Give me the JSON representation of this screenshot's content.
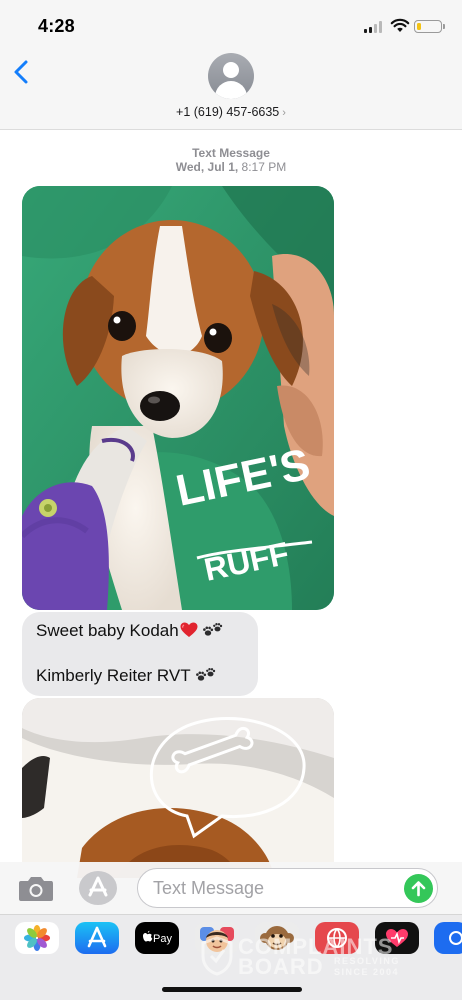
{
  "status_bar": {
    "time": "4:28",
    "cellular_icon": "cellular-signal-icon",
    "wifi_icon": "wifi-icon",
    "battery_icon": "battery-icon",
    "battery_level": 0.2,
    "battery_color": "#f3c316"
  },
  "header": {
    "back_icon": "chevron-left-icon",
    "avatar_icon": "person-avatar-icon",
    "contact": "+1 (619) 457-6635",
    "contact_chevron": "›"
  },
  "thread": {
    "service": "Text Message",
    "date": "Wed, Jul 1,",
    "time": "8:17 PM",
    "photo1": {
      "shirt_text_1": "LIFE'S",
      "shirt_text_2": "RUFF"
    },
    "message": {
      "line1": "Sweet baby Kodah",
      "line2": "Kimberly Reiter RVT",
      "emoji_heart": "red-heart-emoji",
      "emoji_paws": "paw-prints-emoji"
    },
    "bubble_color": "#e9e9eb"
  },
  "compose": {
    "camera_icon": "camera-icon",
    "apps_icon": "app-store-icon",
    "placeholder": "Text Message",
    "send_icon": "send-arrow-icon",
    "send_color": "#34c759"
  },
  "app_drawer": {
    "apps": [
      {
        "name": "photos-app-icon"
      },
      {
        "name": "app-store-app-icon"
      },
      {
        "name": "apple-pay-app-icon",
        "label": "Pay"
      },
      {
        "name": "memoji-app-icon"
      },
      {
        "name": "animoji-monkey-app-icon"
      },
      {
        "name": "search-images-app-icon"
      },
      {
        "name": "digital-touch-app-icon"
      },
      {
        "name": "more-apps-icon"
      }
    ]
  },
  "watermark": {
    "line1": "COMPLAINTS",
    "line2": "BOARD",
    "sub1": "RESOLVING",
    "sub2": "SINCE 2004"
  }
}
